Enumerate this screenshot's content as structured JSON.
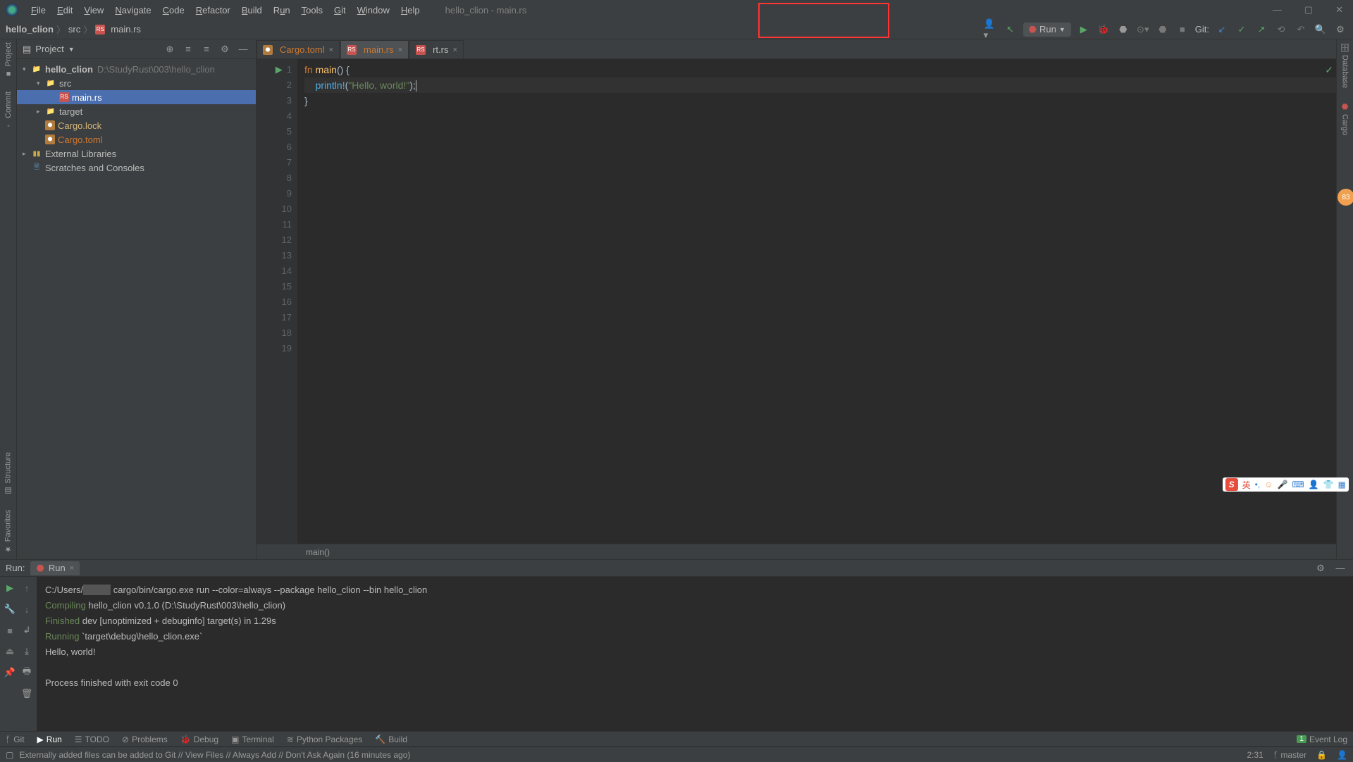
{
  "window": {
    "title": "hello_clion - main.rs"
  },
  "menus": [
    "File",
    "Edit",
    "View",
    "Navigate",
    "Code",
    "Refactor",
    "Build",
    "Run",
    "Tools",
    "Git",
    "Window",
    "Help"
  ],
  "breadcrumb": {
    "root": "hello_clion",
    "mid": "src",
    "file": "main.rs"
  },
  "toolbar": {
    "run_config_label": "Run",
    "git_label": "Git:"
  },
  "left_stripe": {
    "project": "Project",
    "commit": "Commit",
    "structure": "Structure",
    "favorites": "Favorites"
  },
  "right_stripe": {
    "database": "Database",
    "cargo": "Cargo"
  },
  "project_panel": {
    "title": "Project",
    "tree": {
      "root": {
        "name": "hello_clion",
        "path": "D:\\StudyRust\\003\\hello_clion"
      },
      "src": "src",
      "main_rs": "main.rs",
      "target": "target",
      "cargo_lock": "Cargo.lock",
      "cargo_toml": "Cargo.toml",
      "ext_lib": "External Libraries",
      "scratches": "Scratches and Consoles"
    }
  },
  "editor": {
    "tabs": [
      {
        "name": "Cargo.toml",
        "kind": "cargo",
        "active": false
      },
      {
        "name": "main.rs",
        "kind": "rs",
        "active": true
      },
      {
        "name": "rt.rs",
        "kind": "rs",
        "active": false
      }
    ],
    "breadcrumb_fn": "main()",
    "code": {
      "l1_kw": "fn ",
      "l1_fn": "main",
      "l1_rest": "() {",
      "l2_indent": "    ",
      "l2_macro": "println!",
      "l2_paren_open": "(",
      "l2_str": "\"Hello, world!\"",
      "l2_paren_close": ");",
      "l3": "}"
    },
    "line_numbers": [
      "1",
      "2",
      "3",
      "4",
      "5",
      "6",
      "7",
      "8",
      "9",
      "10",
      "11",
      "12",
      "13",
      "14",
      "15",
      "16",
      "17",
      "18",
      "19"
    ]
  },
  "run_panel": {
    "header_label": "Run:",
    "tab_label": "Run",
    "output": {
      "cmd_prefix": "C:/Users/",
      "cmd_rest": " cargo/bin/cargo.exe run --color=always --package hello_clion --bin hello_clion",
      "compiling_kw": "Compiling",
      "compiling_rest": " hello_clion v0.1.0 (D:\\StudyRust\\003\\hello_clion)",
      "finished_kw": "Finished",
      "finished_rest": " dev [unoptimized + debuginfo] target(s) in 1.29s",
      "running_kw": "Running",
      "running_rest": " `target\\debug\\hello_clion.exe`",
      "hello": "Hello, world!",
      "exit": "Process finished with exit code 0"
    }
  },
  "bottom_bar": {
    "git": "Git",
    "run": "Run",
    "todo": "TODO",
    "problems": "Problems",
    "debug": "Debug",
    "terminal": "Terminal",
    "python": "Python Packages",
    "build": "Build",
    "event_log": "Event Log",
    "event_count": "1"
  },
  "status": {
    "msg": "Externally added files can be added to Git // View Files // Always Add // Don't Ask Again (16 minutes ago)",
    "pos": "2:31",
    "branch": "master"
  },
  "ime": {
    "lang": "英"
  },
  "orange_badge": "83"
}
